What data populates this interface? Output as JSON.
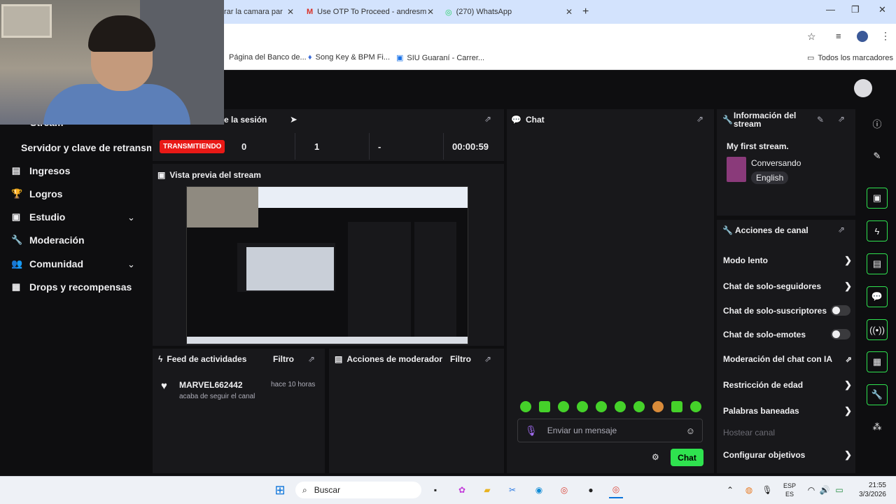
{
  "browser": {
    "tabs": [
      {
        "label": "rar la camara par"
      },
      {
        "label": "Use OTP To Proceed - andresm"
      },
      {
        "label": "(270) WhatsApp"
      }
    ],
    "new_tab": "+",
    "bookmarks": [
      "Página del Banco de...",
      "Song Key & BPM Fi...",
      "SIU Guaraní - Carrer...",
      "Todos los marcadores"
    ]
  },
  "nav": {
    "partial_top": "Stream",
    "server_key": "Servidor y clave de retransm",
    "items": [
      {
        "label": "Ingresos",
        "icon": "ingresos-icon"
      },
      {
        "label": "Logros",
        "icon": "trophy-icon"
      },
      {
        "label": "Estudio",
        "icon": "studio-icon"
      },
      {
        "label": "Moderación",
        "icon": "wrench-icon"
      },
      {
        "label": "Comunidad",
        "icon": "community-icon"
      },
      {
        "label": "Drops y recompensas",
        "icon": "drops-icon"
      }
    ]
  },
  "session": {
    "title_partial": "e la sesión",
    "status_badge": "TRANSMITIENDO",
    "stats": [
      "0",
      "1",
      "-",
      "00:00:59"
    ]
  },
  "preview": {
    "title": "Vista previa del stream"
  },
  "feed": {
    "title": "Feed de actividades",
    "filter": "Filtro",
    "item": {
      "name": "MARVEL662442",
      "time": "hace 10 horas",
      "desc": "acaba de seguir el canal"
    }
  },
  "mod_actions": {
    "title": "Acciones de moderador",
    "filter": "Filtro"
  },
  "chat": {
    "title": "Chat",
    "placeholder": "Enviar un mensaje",
    "send_button": "Chat"
  },
  "stream_info": {
    "title": "Información del stream",
    "stream_title": "My first stream.",
    "category": "Conversando",
    "language": "English"
  },
  "channel_actions": {
    "title": "Acciones de canal",
    "items": [
      {
        "label": "Modo lento",
        "control": "chevron"
      },
      {
        "label": "Chat de solo-seguidores",
        "control": "chevron"
      },
      {
        "label": "Chat de solo-suscriptores",
        "control": "toggle"
      },
      {
        "label": "Chat de solo-emotes",
        "control": "toggle"
      },
      {
        "label": "Moderación del chat con IA",
        "control": "external"
      },
      {
        "label": "Restricción de edad",
        "control": "chevron"
      },
      {
        "label": "Palabras baneadas",
        "control": "chevron"
      },
      {
        "label": "Hostear canal",
        "control": "disabled"
      },
      {
        "label": "Configurar objetivos",
        "control": "chevron"
      }
    ]
  },
  "taskbar": {
    "search_label": "Buscar",
    "lang_top": "ESP",
    "lang_bottom": "ES",
    "time": "21:55",
    "date": "3/3/2026"
  },
  "colors": {
    "live_red": "#e91916",
    "accent_green": "#2fe24f",
    "panel": "#18181b",
    "background": "#0e0e10"
  }
}
